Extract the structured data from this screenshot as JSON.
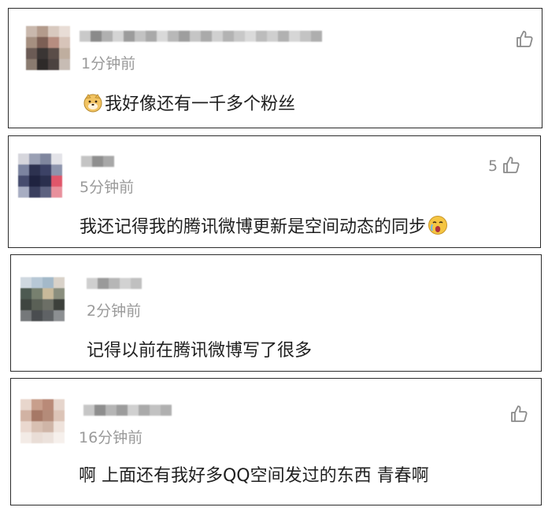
{
  "comments": [
    {
      "time": "1分钟前",
      "text": "我好像还有一千多个粉丝",
      "leading_emoji": "doge-face-icon",
      "likes": ""
    },
    {
      "time": "5分钟前",
      "text": "我还记得我的腾讯微博更新是空间动态的同步",
      "trailing_emoji": "crying-face-icon",
      "likes": "5"
    },
    {
      "time": "2分钟前",
      "text": "记得以前在腾讯微博写了很多",
      "likes": ""
    },
    {
      "time": "16分钟前",
      "text": "啊 上面还有我好多QQ空间发过的东西 青春啊",
      "likes": ""
    }
  ],
  "colors": {
    "border": "#2b2b2b",
    "time": "#9a9a9a",
    "text": "#1f1f1f",
    "like": "#8a8a8a"
  }
}
